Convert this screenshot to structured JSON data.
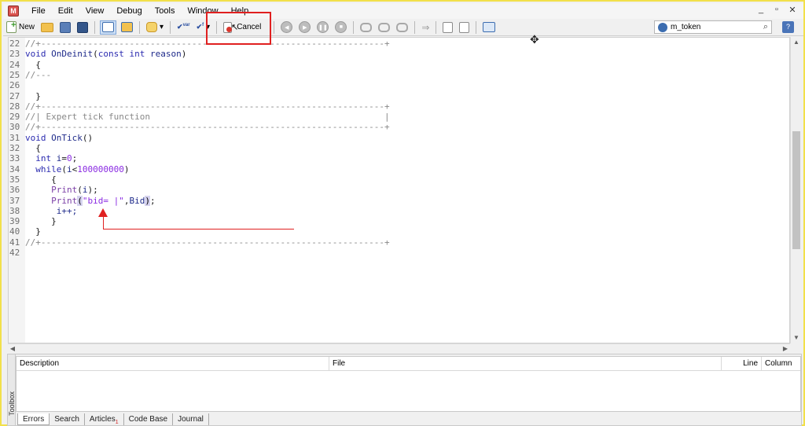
{
  "menu": {
    "app_icon_name": "metaeditor-app-icon",
    "items": [
      "File",
      "Edit",
      "View",
      "Debug",
      "Tools",
      "Window",
      "Help"
    ]
  },
  "window_controls": [
    "_",
    "▫",
    "✕"
  ],
  "toolbar": {
    "new_label": "New",
    "cancel_label": "Cancel"
  },
  "search": {
    "value": "m_token"
  },
  "editor": {
    "lines": [
      {
        "num": "22",
        "tokens": [
          {
            "t": "//+------------------------------------------------------------------+",
            "c": "cm"
          }
        ]
      },
      {
        "num": "23",
        "tokens": [
          {
            "t": "void ",
            "c": "kw"
          },
          {
            "t": "OnDeinit",
            "c": "ident"
          },
          {
            "t": "(",
            "c": "plain"
          },
          {
            "t": "const int ",
            "c": "kw"
          },
          {
            "t": "reason",
            "c": "ident"
          },
          {
            "t": ")",
            "c": "plain"
          }
        ]
      },
      {
        "num": "24",
        "tokens": [
          {
            "t": "  {",
            "c": "plain"
          }
        ]
      },
      {
        "num": "25",
        "tokens": [
          {
            "t": "//---",
            "c": "cm"
          }
        ]
      },
      {
        "num": "26",
        "tokens": [
          {
            "t": "",
            "c": "plain"
          }
        ]
      },
      {
        "num": "27",
        "tokens": [
          {
            "t": "  }",
            "c": "plain"
          }
        ]
      },
      {
        "num": "28",
        "tokens": [
          {
            "t": "//+------------------------------------------------------------------+",
            "c": "cm"
          }
        ]
      },
      {
        "num": "29",
        "tokens": [
          {
            "t": "//| Expert tick function                                             |",
            "c": "cm"
          }
        ]
      },
      {
        "num": "30",
        "tokens": [
          {
            "t": "//+------------------------------------------------------------------+",
            "c": "cm"
          }
        ]
      },
      {
        "num": "31",
        "tokens": [
          {
            "t": "void ",
            "c": "kw"
          },
          {
            "t": "OnTick",
            "c": "ident"
          },
          {
            "t": "()",
            "c": "plain"
          }
        ]
      },
      {
        "num": "32",
        "tokens": [
          {
            "t": "  {",
            "c": "plain"
          }
        ]
      },
      {
        "num": "33",
        "tokens": [
          {
            "t": "  int ",
            "c": "kw"
          },
          {
            "t": "i",
            "c": "ident"
          },
          {
            "t": "=",
            "c": "plain"
          },
          {
            "t": "0",
            "c": "num"
          },
          {
            "t": ";",
            "c": "plain"
          }
        ]
      },
      {
        "num": "34",
        "tokens": [
          {
            "t": "  while",
            "c": "kw"
          },
          {
            "t": "(",
            "c": "plain"
          },
          {
            "t": "i",
            "c": "ident"
          },
          {
            "t": "<",
            "c": "plain"
          },
          {
            "t": "100000000",
            "c": "num"
          },
          {
            "t": ")",
            "c": "plain"
          }
        ]
      },
      {
        "num": "35",
        "tokens": [
          {
            "t": "     {",
            "c": "plain"
          }
        ]
      },
      {
        "num": "36",
        "tokens": [
          {
            "t": "     Print",
            "c": "fn"
          },
          {
            "t": "(",
            "c": "plain"
          },
          {
            "t": "i",
            "c": "ident"
          },
          {
            "t": ");",
            "c": "plain"
          }
        ]
      },
      {
        "num": "37",
        "tokens": [
          {
            "t": "     Print",
            "c": "fn"
          },
          {
            "t": "(",
            "c": "hl"
          },
          {
            "t": "\"bid= |\"",
            "c": "str"
          },
          {
            "t": ",",
            "c": "plain"
          },
          {
            "t": "Bid",
            "c": "ident"
          },
          {
            "t": ")",
            "c": "hl"
          },
          {
            "t": ";",
            "c": "plain"
          }
        ]
      },
      {
        "num": "38",
        "tokens": [
          {
            "t": "      i++;",
            "c": "ident"
          }
        ]
      },
      {
        "num": "39",
        "tokens": [
          {
            "t": "     }",
            "c": "plain"
          }
        ]
      },
      {
        "num": "40",
        "tokens": [
          {
            "t": "  }",
            "c": "plain"
          }
        ]
      },
      {
        "num": "41",
        "tokens": [
          {
            "t": "//+------------------------------------------------------------------+",
            "c": "cm"
          }
        ]
      },
      {
        "num": "42",
        "tokens": [
          {
            "t": "",
            "c": "plain"
          }
        ]
      }
    ]
  },
  "toolbox": {
    "side_label": "Toolbox",
    "columns": [
      "Description",
      "File",
      "Line",
      "Column"
    ],
    "tabs": [
      {
        "label": "Errors",
        "badge": ""
      },
      {
        "label": "Search",
        "badge": ""
      },
      {
        "label": "Articles",
        "badge": "1"
      },
      {
        "label": "Code Base",
        "badge": ""
      },
      {
        "label": "Journal",
        "badge": ""
      }
    ]
  },
  "colors": {
    "frame_border": "#f2e04a",
    "annotation_red": "#e02020",
    "keyword": "#2b2bb0",
    "comment": "#888888",
    "number": "#8a2be2"
  }
}
